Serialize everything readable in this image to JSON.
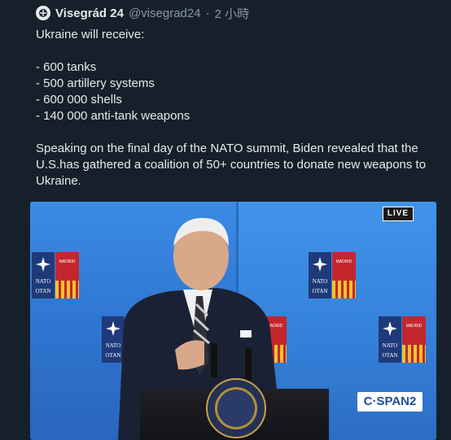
{
  "tweet": {
    "author_name": "Visegrád 24",
    "handle": "@visegrad24",
    "separator": "·",
    "time": "2 小時",
    "intro": "Ukraine will receive:",
    "items": [
      "- 600 tanks",
      "- 500 artillery systems",
      "- 600 000 shells",
      "- 140 000 anti-tank weapons"
    ],
    "paragraph": "Speaking on the final day of the NATO summit, Biden revealed that the U.S.has gathered a coalition of 50+ countries to donate new weapons to Ukraine."
  },
  "video": {
    "live_badge": "LIVE",
    "network_logo": "C·SPAN2",
    "backdrop_labels": {
      "nato_line1": "NATO",
      "nato_line2": "OTAN",
      "madrid": "MADRID"
    }
  },
  "colors": {
    "background": "#15202b",
    "text": "#e7e9ea",
    "muted": "#8b98a5",
    "backdrop_blue": "#2f7ad6"
  }
}
